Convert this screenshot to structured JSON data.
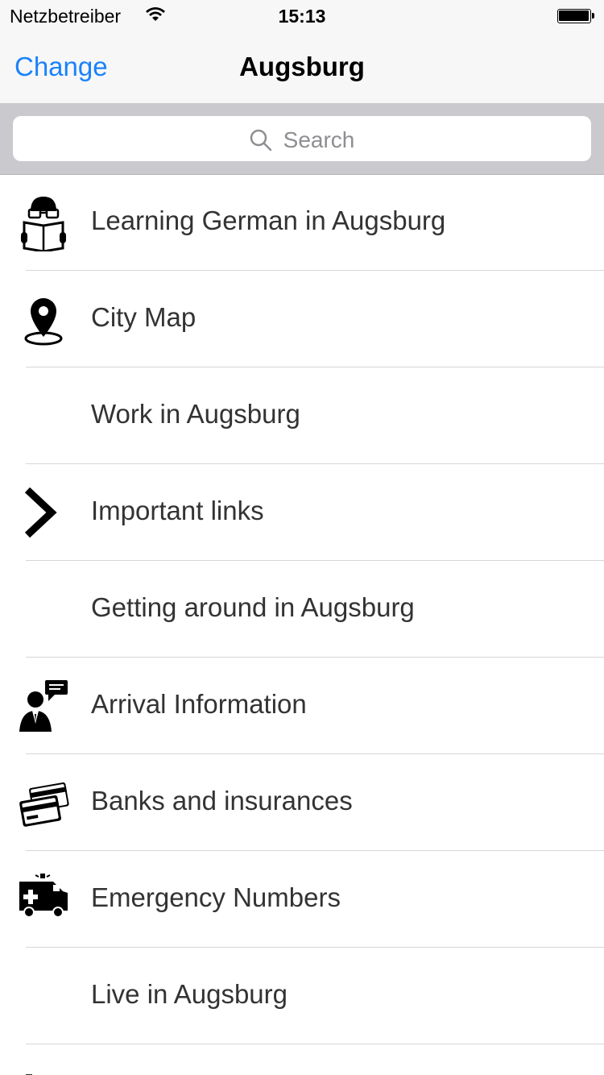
{
  "status_bar": {
    "carrier": "Netzbetreiber",
    "time": "15:13"
  },
  "nav": {
    "back_label": "Change",
    "title": "Augsburg"
  },
  "search": {
    "placeholder": "Search"
  },
  "colors": {
    "accent": "#1a82fb",
    "search_background": "#c9c9ce",
    "bar_background": "#f7f7f7"
  },
  "list": {
    "items": [
      {
        "label": "Learning German in Augsburg",
        "icon": "reading-person-icon"
      },
      {
        "label": "City Map",
        "icon": "map-pin-icon"
      },
      {
        "label": "Work in Augsburg",
        "icon": ""
      },
      {
        "label": "Important links",
        "icon": "chevron-right-icon"
      },
      {
        "label": "Getting around in Augsburg",
        "icon": ""
      },
      {
        "label": "Arrival Information",
        "icon": "person-speech-bubble-icon"
      },
      {
        "label": "Banks and insurances",
        "icon": "credit-cards-icon"
      },
      {
        "label": "Emergency Numbers",
        "icon": "ambulance-icon"
      },
      {
        "label": "Live in Augsburg",
        "icon": ""
      }
    ]
  }
}
